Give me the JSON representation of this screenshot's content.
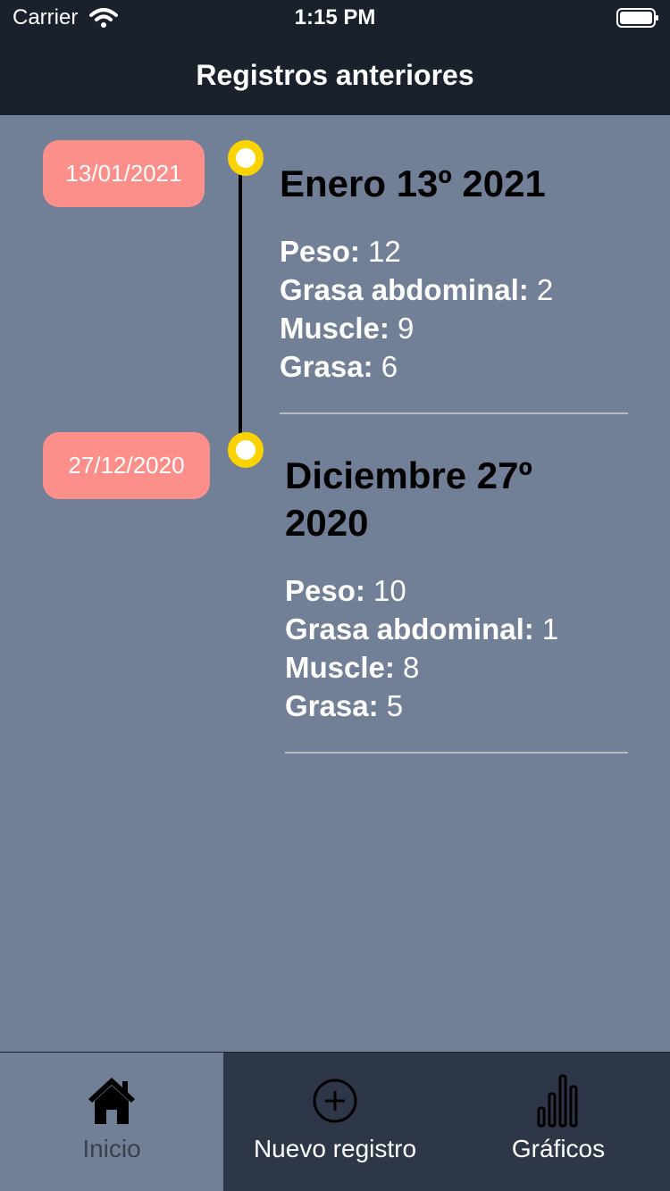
{
  "status_bar": {
    "carrier": "Carrier",
    "time": "1:15 PM",
    "wifi_icon": "wifi-icon",
    "battery_icon": "battery-full-icon"
  },
  "header": {
    "title": "Registros anteriores"
  },
  "colors": {
    "bar_background": "#1a202c",
    "content_background": "#718096",
    "tab_bar_background": "#2d3748",
    "date_pill": "#fc8f8a",
    "timeline_dot": "#fad300"
  },
  "records": [
    {
      "date": "13/01/2021",
      "title": "Enero 13º 2021",
      "stats": [
        {
          "label": "Peso:",
          "value": "12"
        },
        {
          "label": "Grasa abdominal:",
          "value": "2"
        },
        {
          "label": "Muscle:",
          "value": "9"
        },
        {
          "label": "Grasa:",
          "value": "6"
        }
      ]
    },
    {
      "date": "27/12/2020",
      "title": "Diciembre 27º 2020",
      "stats": [
        {
          "label": "Peso:",
          "value": "10"
        },
        {
          "label": "Grasa abdominal:",
          "value": "1"
        },
        {
          "label": "Muscle:",
          "value": "8"
        },
        {
          "label": "Grasa:",
          "value": "5"
        }
      ]
    }
  ],
  "tabs": [
    {
      "label": "Inicio",
      "icon": "home-icon",
      "active": true
    },
    {
      "label": "Nuevo registro",
      "icon": "plus-circle-icon",
      "active": false
    },
    {
      "label": "Gráficos",
      "icon": "bar-chart-icon",
      "active": false
    }
  ]
}
